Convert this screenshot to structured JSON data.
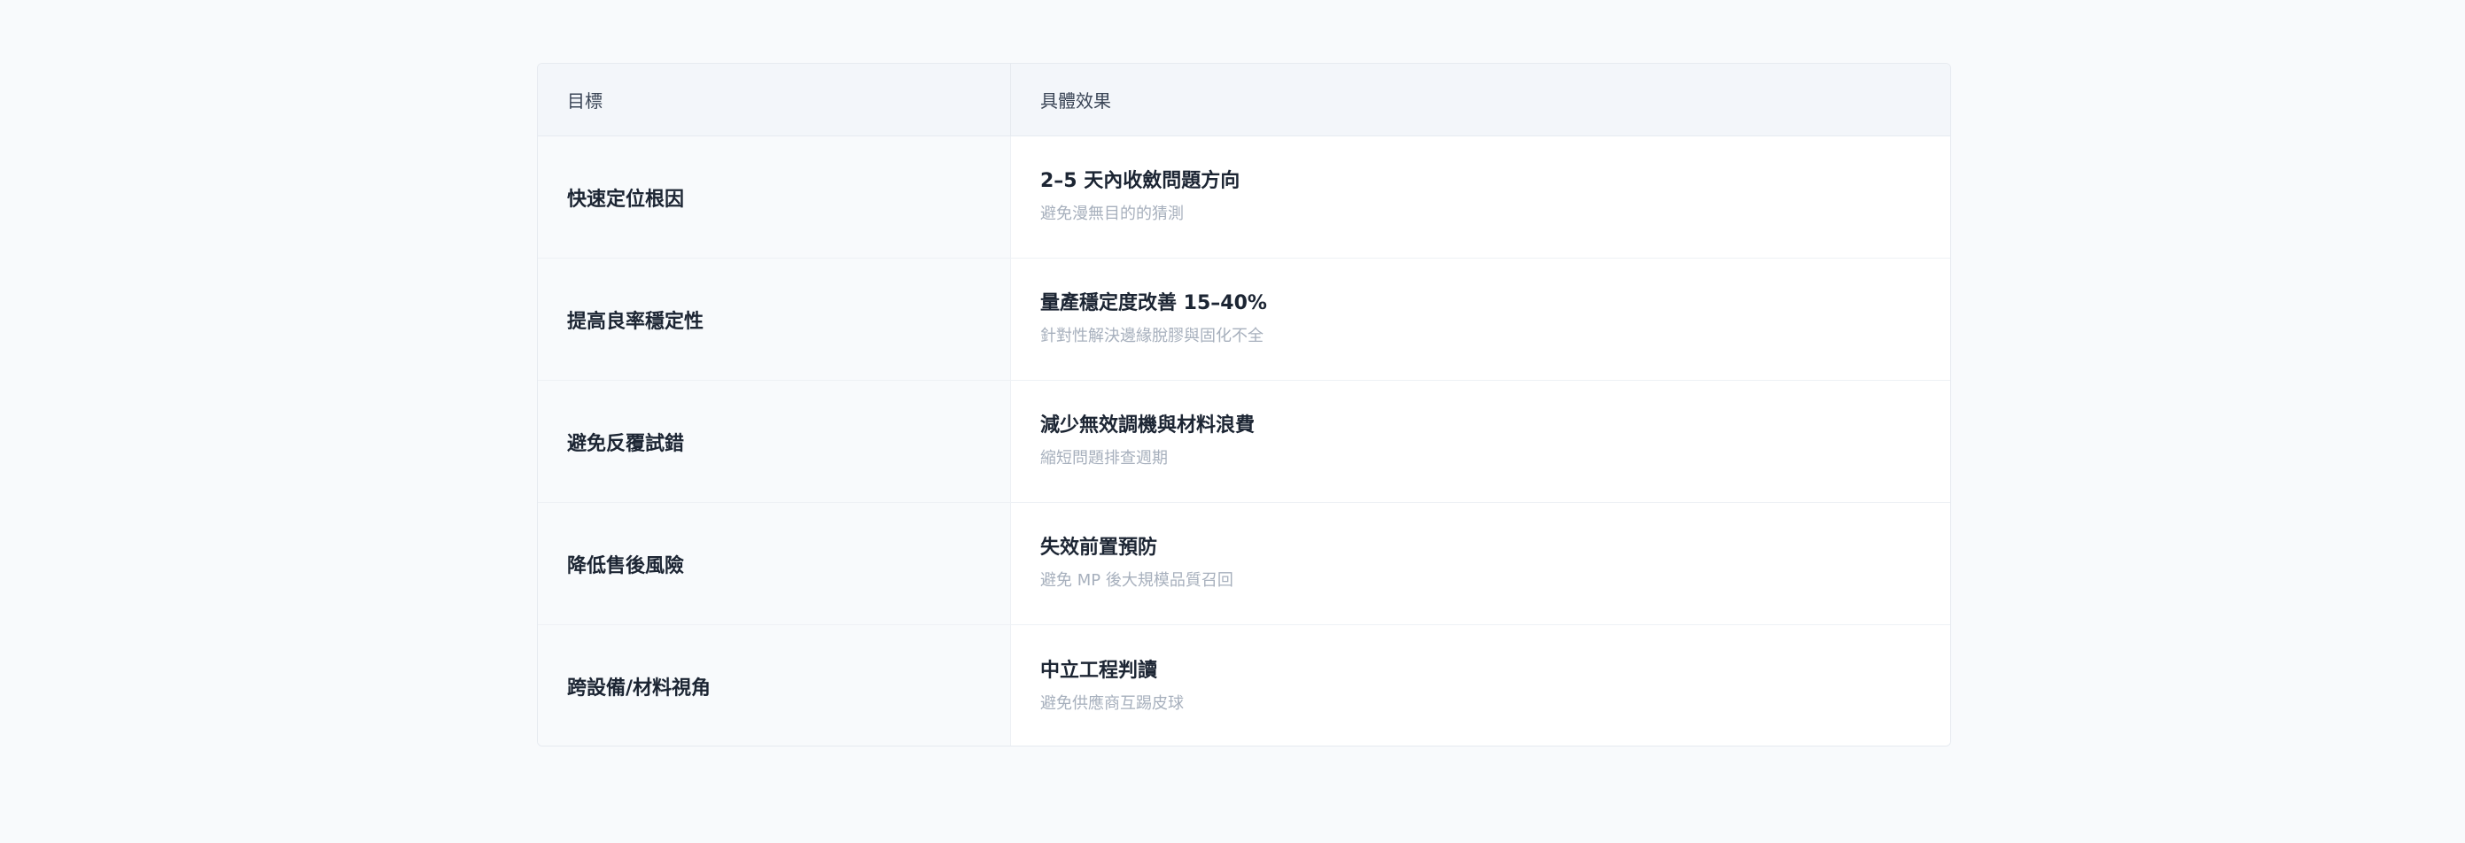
{
  "table": {
    "headers": {
      "goal": "目標",
      "effect": "具體效果"
    },
    "rows": [
      {
        "goal": "快速定位根因",
        "effect_main": "2–5 天內收斂問題方向",
        "effect_sub": "避免漫無目的的猜測"
      },
      {
        "goal": "提高良率穩定性",
        "effect_main": "量產穩定度改善 15–40%",
        "effect_sub": "針對性解決邊緣脫膠與固化不全"
      },
      {
        "goal": "避免反覆試錯",
        "effect_main": "減少無效調機與材料浪費",
        "effect_sub": "縮短問題排查週期"
      },
      {
        "goal": "降低售後風險",
        "effect_main": "失效前置預防",
        "effect_sub": "避免 MP 後大規模品質召回"
      },
      {
        "goal": "跨設備/材料視角",
        "effect_main": "中立工程判讀",
        "effect_sub": "避免供應商互踢皮球"
      }
    ]
  }
}
